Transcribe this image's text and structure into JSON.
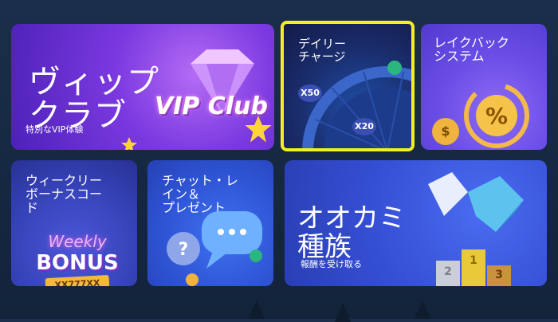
{
  "tiles": {
    "vip": {
      "title": "ヴィップ\nクラブ",
      "subtitle": "特別なVIP体験",
      "logo": "VIP Club"
    },
    "daily": {
      "title": "デイリー\nチャージ",
      "badge_x50": "X50",
      "badge_x20": "X20"
    },
    "rakeback": {
      "title": "レイクバック\nシステム"
    },
    "weekly": {
      "title": "ウィークリー\nボーナスコー\nド",
      "weekly": "Weekly",
      "bonus": "BONUS",
      "code": "XX777XX"
    },
    "chat": {
      "title": "チャット・レ\nイン＆\nプレゼント"
    },
    "wolf": {
      "title": "オオカミ\n種族",
      "subtitle": "報酬を受け取る",
      "podium": [
        "2",
        "1",
        "3"
      ]
    }
  },
  "colors": {
    "highlight": "#f4ef1f",
    "vip_bg": "#7b39e0",
    "daily_bg": "#1a2c6b",
    "rake_bg": "#6a4de6",
    "weekly_bg": "#3542b6",
    "chat_bg": "#3057d8",
    "wolf_bg": "#3650d6"
  }
}
